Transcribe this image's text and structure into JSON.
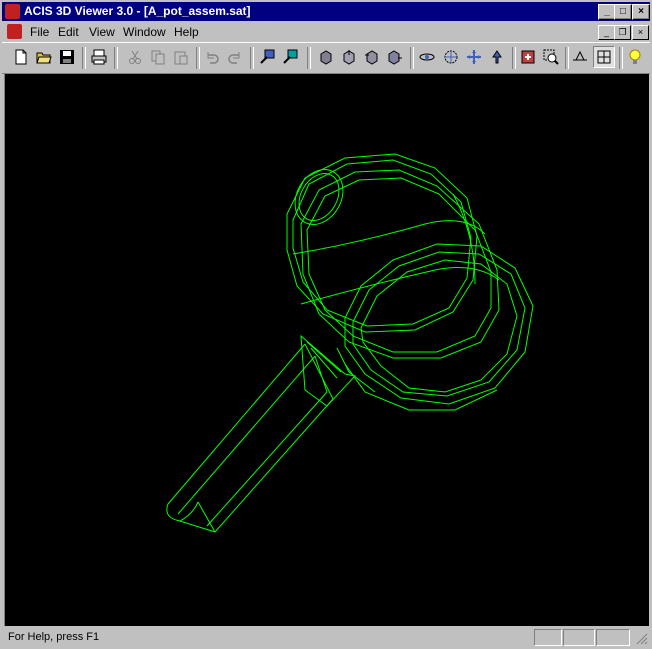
{
  "window": {
    "title": "ACIS 3D Viewer 3.0 - [A_pot_assem.sat]",
    "caption_buttons": [
      "minimize",
      "maximize",
      "close"
    ]
  },
  "menubar": {
    "items": [
      {
        "label": "File"
      },
      {
        "label": "Edit"
      },
      {
        "label": "View"
      },
      {
        "label": "Window"
      },
      {
        "label": "Help"
      }
    ]
  },
  "toolbar": {
    "buttons": [
      {
        "name": "new-icon"
      },
      {
        "name": "open-icon"
      },
      {
        "name": "save-icon"
      },
      {
        "name": "print-icon"
      },
      {
        "name": "cut-icon",
        "disabled": true
      },
      {
        "name": "copy-icon",
        "disabled": true
      },
      {
        "name": "paste-icon",
        "disabled": true
      },
      {
        "name": "undo-icon",
        "disabled": true
      },
      {
        "name": "redo-icon",
        "disabled": true
      },
      {
        "name": "select-icon"
      },
      {
        "name": "select-all-icon"
      },
      {
        "name": "view-front-icon"
      },
      {
        "name": "view-top-icon"
      },
      {
        "name": "view-side-icon"
      },
      {
        "name": "view-iso-icon"
      },
      {
        "name": "orbit-icon"
      },
      {
        "name": "rotate-icon"
      },
      {
        "name": "pan-icon"
      },
      {
        "name": "walk-icon"
      },
      {
        "name": "zoom-fit-icon"
      },
      {
        "name": "zoom-window-icon"
      },
      {
        "name": "perspective-icon"
      },
      {
        "name": "wireframe-icon",
        "pressed": true
      },
      {
        "name": "light-icon"
      }
    ]
  },
  "viewport": {
    "render_mode": "wireframe",
    "background": "#000000",
    "wire_color": "#00ff00"
  },
  "statusbar": {
    "text": "For Help, press F1"
  },
  "colors": {
    "title_bg": "#000080",
    "chrome": "#c0c0c0",
    "wire": "#00ff00"
  }
}
